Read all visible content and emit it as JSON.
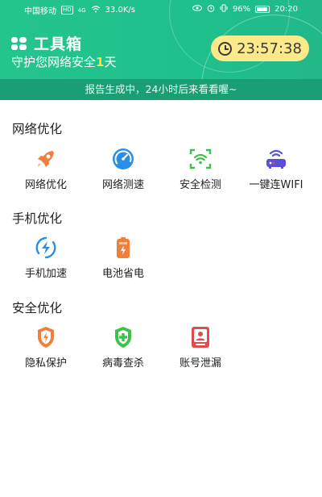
{
  "status_bar": {
    "carrier": "中国移动",
    "hd_tag": "HD",
    "net_tag": "4G",
    "speed": "33.0K/s",
    "battery": "96%",
    "time": "20:20"
  },
  "header": {
    "title": "工具箱",
    "subtitle_prefix": "守护您网络安全",
    "days": "1",
    "subtitle_suffix": "天",
    "timer": "23:57:38",
    "banner": "报告生成中，24小时后来看看喔~"
  },
  "sections": [
    {
      "title": "网络优化",
      "items": [
        {
          "label": "网络优化",
          "icon": "rocket-icon",
          "color": "#f07f3c"
        },
        {
          "label": "网络测速",
          "icon": "speedometer-icon",
          "color": "#2a8ee8"
        },
        {
          "label": "安全检测",
          "icon": "wifi-scan-icon",
          "color": "#3cc24a"
        },
        {
          "label": "一键连WIFI",
          "icon": "router-icon",
          "color": "#5b4fd8"
        }
      ]
    },
    {
      "title": "手机优化",
      "items": [
        {
          "label": "手机加速",
          "icon": "lightning-circle-icon",
          "color": "#2a8ee8"
        },
        {
          "label": "电池省电",
          "icon": "battery-icon",
          "color": "#f07f3c"
        }
      ]
    },
    {
      "title": "安全优化",
      "items": [
        {
          "label": "隐私保护",
          "icon": "privacy-shield-icon",
          "color": "#f07f3c"
        },
        {
          "label": "病毒查杀",
          "icon": "virus-shield-icon",
          "color": "#3cc24a"
        },
        {
          "label": "账号泄漏",
          "icon": "account-card-icon",
          "color": "#e04c4c"
        }
      ]
    }
  ]
}
